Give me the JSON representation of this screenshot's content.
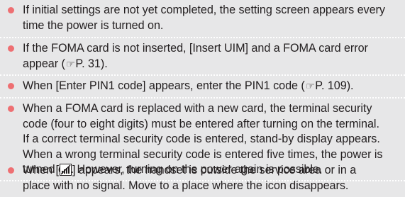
{
  "colors": {
    "background": "#e7e7e8",
    "bullet": "#ee6f72",
    "text": "#231f20",
    "divider": "#ffffff"
  },
  "notes": [
    {
      "lines": [
        "If initial settings are not yet completed, the setting screen appears every",
        "time the power is turned on."
      ]
    },
    {
      "line1": "If the FOMA card is not inserted, [Insert UIM] and a FOMA card error",
      "line2_before": "appear (",
      "ref_icon": "☞",
      "line2_after": "P. 31)."
    },
    {
      "before": "When [Enter PIN1 code] appears, enter the PIN1 code (",
      "ref_icon": "☞",
      "after": "P. 109)."
    },
    {
      "lines": [
        "When a FOMA card is replaced with a new card, the terminal security",
        "code (four to eight digits) must be entered after turning on the terminal.",
        "If a correct terminal security code is entered, stand-by display appears.",
        "When a wrong terminal security code is entered five times, the power is",
        "turned off. However, turning on the power again is possible."
      ]
    },
    {
      "line1_before": "When [",
      "signal_icon": "out-of-service-icon",
      "line1_after": "] appears, the handset is outside the service area or in a",
      "line2": "place with no signal. Move to a place where the icon disappears."
    }
  ]
}
